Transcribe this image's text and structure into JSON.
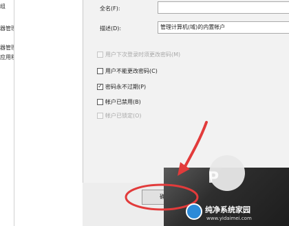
{
  "left_panel": {
    "items": [
      "组",
      "器管理器",
      "",
      "器管理",
      "应用程序"
    ]
  },
  "dialog": {
    "fullname_label": "全名(F):",
    "fullname_value": "",
    "description_label": "描述(D):",
    "description_value": "管理计算机(域)的内置帐户",
    "checkboxes": [
      {
        "label": "用户下次登录时须更改密码(M)",
        "checked": false,
        "enabled": false
      },
      {
        "label": "用户不能更改密码(C)",
        "checked": false,
        "enabled": true
      },
      {
        "label": "密码永不过期(P)",
        "checked": true,
        "enabled": true
      },
      {
        "label": "帐户已禁用(B)",
        "checked": false,
        "enabled": true
      },
      {
        "label": "帐户已锁定(O)",
        "checked": false,
        "enabled": false
      }
    ],
    "ok_label": "确"
  },
  "annotation": {
    "color": "#e23b3b",
    "shapes": [
      "arrow",
      "ellipse"
    ]
  },
  "watermark": {
    "title": "纯净系统家园",
    "url": "www.yidaimei.com",
    "logo_color": "#2c8ad8"
  }
}
